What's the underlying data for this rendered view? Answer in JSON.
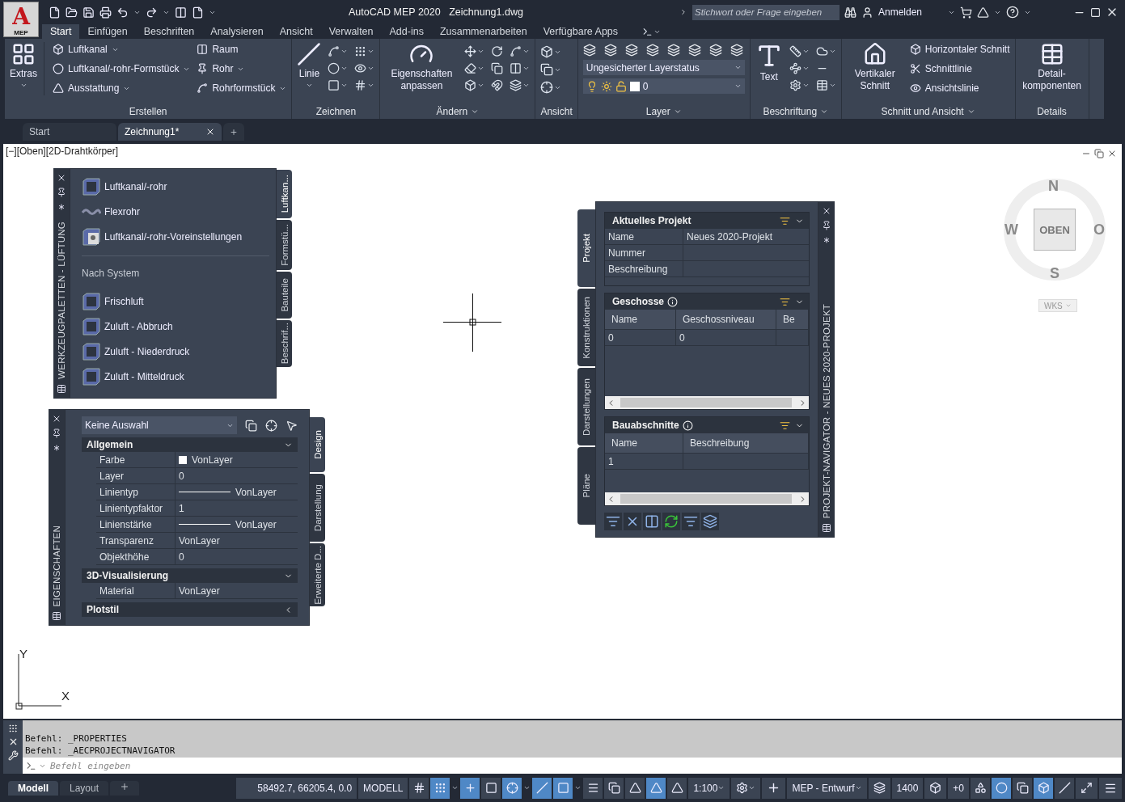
{
  "app_button": {
    "letter": "A",
    "label": "MEP"
  },
  "title": {
    "app": "AutoCAD MEP 2020",
    "file": "Zeichnung1.dwg"
  },
  "search": {
    "placeholder": "Stichwort oder Frage eingeben"
  },
  "account": {
    "label": "Anmelden"
  },
  "ribbon_tabs": [
    {
      "label": "Start",
      "selected": true
    },
    {
      "label": "Einfügen",
      "selected": false
    },
    {
      "label": "Beschriften",
      "selected": false
    },
    {
      "label": "Analysieren",
      "selected": false
    },
    {
      "label": "Ansicht",
      "selected": false
    },
    {
      "label": "Verwalten",
      "selected": false
    },
    {
      "label": "Add-ins",
      "selected": false
    },
    {
      "label": "Zusammenarbeiten",
      "selected": false
    },
    {
      "label": "Verfügbare Apps",
      "selected": false
    }
  ],
  "ribbon_panels": [
    {
      "kind": "create",
      "title": "Erstellen",
      "menu": false,
      "large": "Extras",
      "items": [
        {
          "label": "Luftkanal",
          "dropdown": true
        },
        {
          "label": "Luftkanal/-rohr-Formstück",
          "dropdown": true
        },
        {
          "label": "Ausstattung",
          "dropdown": true
        },
        {
          "label": "Raum",
          "dropdown": false
        },
        {
          "label": "Rohr",
          "dropdown": true
        },
        {
          "label": "Rohrformstück",
          "dropdown": true
        }
      ]
    },
    {
      "kind": "draw",
      "title": "Zeichnen",
      "menu": false,
      "large": "Linie"
    },
    {
      "kind": "modify",
      "title": "Ändern",
      "menu": true,
      "large": "Eigenschaften anpassen"
    },
    {
      "kind": "view",
      "title": "Ansicht",
      "menu": false
    },
    {
      "kind": "layer",
      "title": "Layer",
      "menu": true,
      "state": "Ungesicherter Layerstatus",
      "layer": "0"
    },
    {
      "kind": "annotate",
      "title": "Beschriftung",
      "menu": true,
      "large": "Text"
    },
    {
      "kind": "section",
      "title": "Schnitt und Ansicht",
      "menu": true,
      "large": "Vertikaler Schnitt",
      "items": [
        {
          "label": "Horizontaler Schnitt"
        },
        {
          "label": "Schnittlinie"
        },
        {
          "label": "Ansichtslinie"
        }
      ]
    },
    {
      "kind": "details",
      "title": "Details",
      "menu": false,
      "large": "Detail-komponenten"
    }
  ],
  "doc_tabs": [
    {
      "label": "Start",
      "selected": false
    },
    {
      "label": "Zeichnung1*",
      "selected": true
    }
  ],
  "viewport": {
    "label": "[−][Oben][2D-Drahtkörper]"
  },
  "viewcube": {
    "north": "N",
    "west": "W",
    "east": "O",
    "south": "S",
    "face": "OBEN",
    "ucs": "WKS"
  },
  "ucs_icon": {
    "x": "X",
    "y": "Y"
  },
  "tool_palette": {
    "title": "WERKZEUGPALETTEN - LÜFTUNG",
    "tabs": [
      {
        "label": "Luftkan...",
        "selected": true
      },
      {
        "label": "Formstü...",
        "selected": false
      },
      {
        "label": "Bauteile",
        "selected": false
      },
      {
        "label": "Beschrif...",
        "selected": false
      }
    ],
    "items": [
      {
        "kind": "duct",
        "label": "Luftkanal/-rohr"
      },
      {
        "kind": "flex",
        "label": "Flexrohr"
      },
      {
        "kind": "preset",
        "label": "Luftkanal/-rohr-Voreinstellungen"
      },
      {
        "kind": "heading",
        "label": "Nach System"
      },
      {
        "kind": "duct",
        "label": "Frischluft"
      },
      {
        "kind": "duct",
        "label": "Zuluft - Abbruch"
      },
      {
        "kind": "duct",
        "label": "Zuluft - Niederdruck"
      },
      {
        "kind": "duct",
        "label": "Zuluft - Mitteldruck"
      }
    ]
  },
  "properties": {
    "title": "EIGENSCHAFTEN",
    "selection": "Keine Auswahl",
    "tabs": [
      {
        "label": "Design",
        "selected": true
      },
      {
        "label": "Darstellung",
        "selected": false
      },
      {
        "label": "Erweiterte D...",
        "selected": false
      }
    ],
    "sections": [
      {
        "title": "Allgemein",
        "expanded": true,
        "rows": [
          {
            "kind": "color",
            "label": "Farbe",
            "value": "VonLayer"
          },
          {
            "kind": "text",
            "label": "Layer",
            "value": "0"
          },
          {
            "kind": "linetype",
            "label": "Linientyp",
            "value": "VonLayer"
          },
          {
            "kind": "text",
            "label": "Linientypfaktor",
            "value": "1"
          },
          {
            "kind": "linetype",
            "label": "Linienstärke",
            "value": "VonLayer"
          },
          {
            "kind": "text",
            "label": "Transparenz",
            "value": "VonLayer"
          },
          {
            "kind": "text",
            "label": "Objekthöhe",
            "value": "0"
          }
        ]
      },
      {
        "title": "3D-Visualisierung",
        "expanded": true,
        "rows": [
          {
            "kind": "text",
            "label": "Material",
            "value": "VonLayer"
          }
        ]
      },
      {
        "title": "Plotstil",
        "expanded": false
      }
    ]
  },
  "project_navigator": {
    "title": "PROJEKT-NAVIGATOR - NEUES 2020-PROJEKT",
    "tabs": [
      {
        "label": "Projekt",
        "selected": true
      },
      {
        "label": "Konstruktionen",
        "selected": false
      },
      {
        "label": "Darstellungen",
        "selected": false
      },
      {
        "label": "Pläne",
        "selected": false
      }
    ],
    "current_project": {
      "title": "Aktuelles Projekt",
      "fields": [
        {
          "label": "Name",
          "value": "Neues 2020-Projekt"
        },
        {
          "label": "Nummer"
        },
        {
          "label": "Beschreibung"
        }
      ]
    },
    "levels": {
      "title": "Geschosse",
      "columns": [
        "Name",
        "Geschossniveau",
        "Be"
      ],
      "rows": [
        [
          "0",
          "0"
        ]
      ]
    },
    "divisions": {
      "title": "Bauabschnitte",
      "columns": [
        "Name",
        "Beschreibung"
      ],
      "rows": [
        [
          "1"
        ]
      ]
    }
  },
  "command_line": {
    "history": [
      "Befehl: _PROPERTIES",
      "Befehl: _AECPROJECTNAVIGATOR"
    ],
    "placeholder": "Befehl eingeben"
  },
  "layout_tabs": [
    {
      "label": "Modell",
      "selected": true
    },
    {
      "label": "Layout",
      "selected": false
    }
  ],
  "status_bar": {
    "coordinates": "58492.7, 66205.4, 0.0",
    "space": "MODELL",
    "toggles": [
      {
        "on": false
      },
      {
        "on": true
      },
      {
        "on": true
      },
      {
        "on": false
      },
      {
        "on": true
      },
      {
        "on": true
      },
      {
        "on": true
      },
      {
        "on": false
      },
      {
        "on": false
      },
      {
        "on": false
      },
      {
        "on": true
      },
      {
        "on": false
      }
    ],
    "scale": "1:100",
    "workspace": "MEP - Entwurf",
    "elevation": "1400",
    "offset": "+0",
    "extra_toggles": [
      {
        "on": false
      },
      {
        "on": true
      },
      {
        "on": false
      },
      {
        "on": true
      },
      {
        "on": false
      }
    ]
  }
}
